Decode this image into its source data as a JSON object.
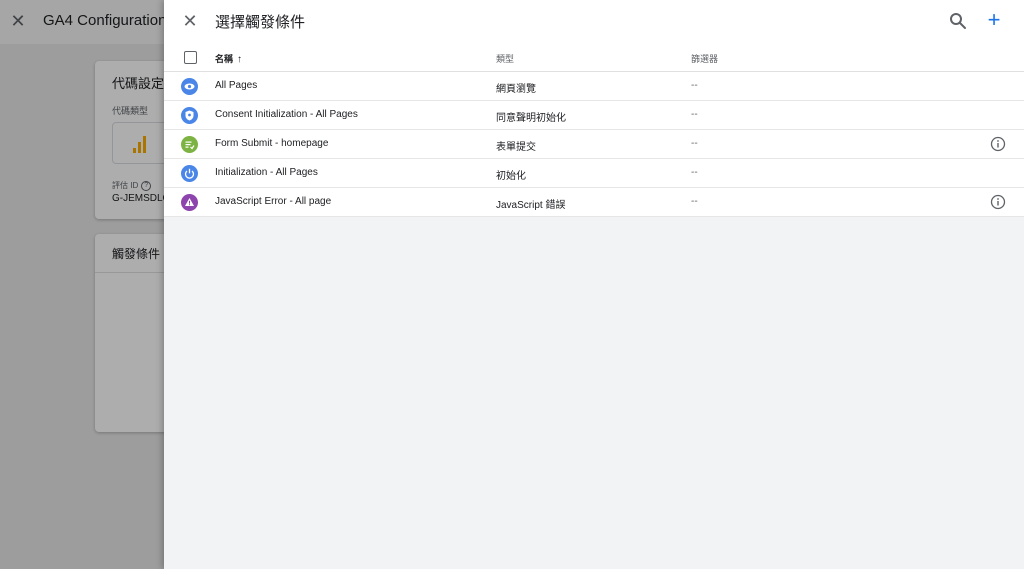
{
  "background": {
    "title": "GA4 Configuration",
    "tag_config_card": {
      "title": "代碼設定",
      "tag_type_label": "代碼類型",
      "measurement_id_label": "評估 ID",
      "measurement_id_value": "G-JEMSDLC"
    },
    "triggering_card": {
      "title": "觸發條件"
    }
  },
  "panel": {
    "title": "選擇觸發條件",
    "columns": {
      "name": "名稱",
      "type": "類型",
      "filter": "篩選器"
    },
    "rows": [
      {
        "name": "All Pages",
        "type": "網頁瀏覽",
        "filter": "--",
        "icon": "eye-icon",
        "color": "#4a86e8",
        "info": false
      },
      {
        "name": "Consent Initialization - All Pages",
        "type": "同意聲明初始化",
        "filter": "--",
        "icon": "shield-icon",
        "color": "#4a86e8",
        "info": false
      },
      {
        "name": "Form Submit - homepage",
        "type": "表單提交",
        "filter": "--",
        "icon": "form-icon",
        "color": "#7cb342",
        "info": true
      },
      {
        "name": "Initialization - All Pages",
        "type": "初始化",
        "filter": "--",
        "icon": "power-icon",
        "color": "#4a86e8",
        "info": false
      },
      {
        "name": "JavaScript Error - All page",
        "type": "JavaScript 錯誤",
        "filter": "--",
        "icon": "warning-icon",
        "color": "#8e44ad",
        "info": true
      }
    ]
  },
  "colors": {
    "accent": "#1a73e8",
    "analytics_orange": "#f9ab00"
  }
}
